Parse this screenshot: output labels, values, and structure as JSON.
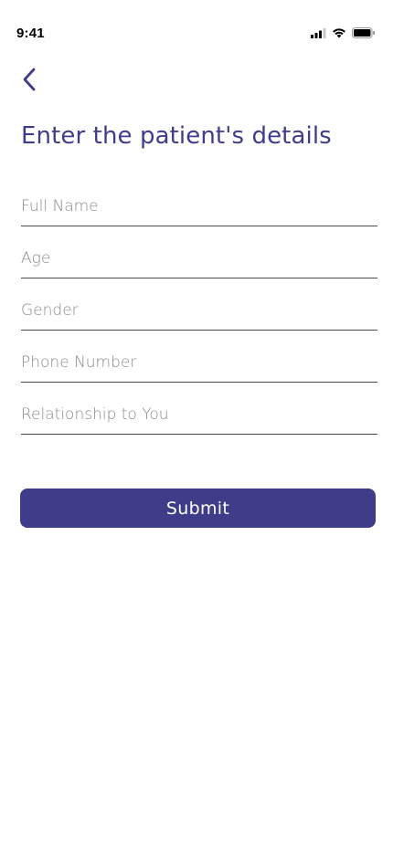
{
  "status_bar": {
    "time": "9:41"
  },
  "header": {
    "title": "Enter the patient's details"
  },
  "form": {
    "fields": [
      {
        "name": "full-name",
        "placeholder": "Full Name",
        "value": ""
      },
      {
        "name": "age",
        "placeholder": "Age",
        "value": ""
      },
      {
        "name": "gender",
        "placeholder": "Gender",
        "value": ""
      },
      {
        "name": "phone-number",
        "placeholder": "Phone Number",
        "value": ""
      },
      {
        "name": "relationship",
        "placeholder": "Relationship to You",
        "value": ""
      }
    ],
    "submit_label": "Submit"
  },
  "colors": {
    "accent": "#3f3d8a",
    "underline": "#4a4a4a",
    "placeholder": "#8a8a8a"
  },
  "icons": {
    "back": "chevron-left-icon",
    "signal": "cellular-signal-icon",
    "wifi": "wifi-icon",
    "battery": "battery-icon"
  }
}
